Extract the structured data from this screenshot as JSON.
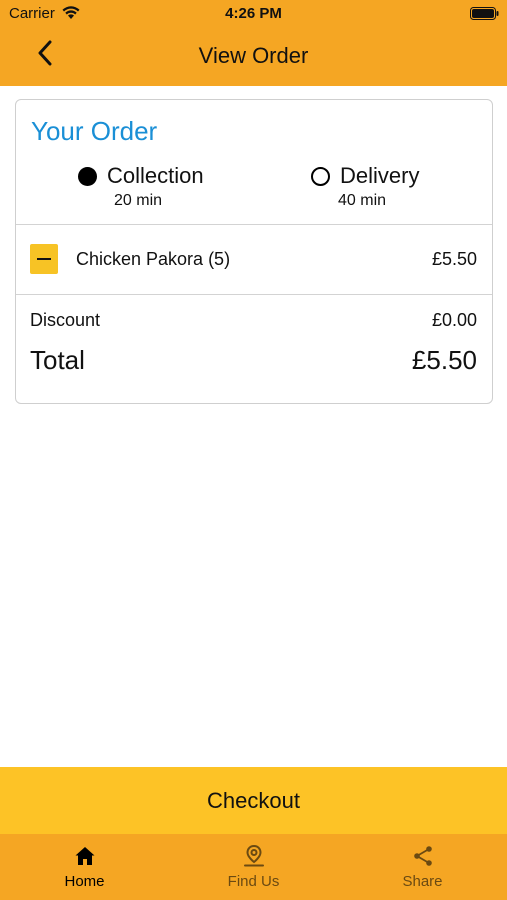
{
  "status_bar": {
    "carrier": "Carrier",
    "time": "4:26 PM"
  },
  "nav": {
    "title": "View Order",
    "back_icon": "chevron-left-icon"
  },
  "order": {
    "heading": "Your Order",
    "options": [
      {
        "label": "Collection",
        "time": "20 min",
        "selected": true
      },
      {
        "label": "Delivery",
        "time": "40 min",
        "selected": false
      }
    ],
    "items": [
      {
        "name": "Chicken Pakora (5)",
        "price": "£5.50",
        "action_icon": "minus-icon"
      }
    ],
    "discount_label": "Discount",
    "discount_value": "£0.00",
    "total_label": "Total",
    "total_value": "£5.50"
  },
  "checkout_label": "Checkout",
  "tabs": [
    {
      "label": "Home",
      "icon": "home-icon",
      "active": true
    },
    {
      "label": "Find Us",
      "icon": "location-pin-icon",
      "active": false
    },
    {
      "label": "Share",
      "icon": "share-icon",
      "active": false
    }
  ],
  "colors": {
    "header_bg": "#f5a623",
    "checkout_bg": "#fdc326",
    "heading_blue": "#1a8fd6",
    "minus_button_bg": "#f7c325"
  }
}
